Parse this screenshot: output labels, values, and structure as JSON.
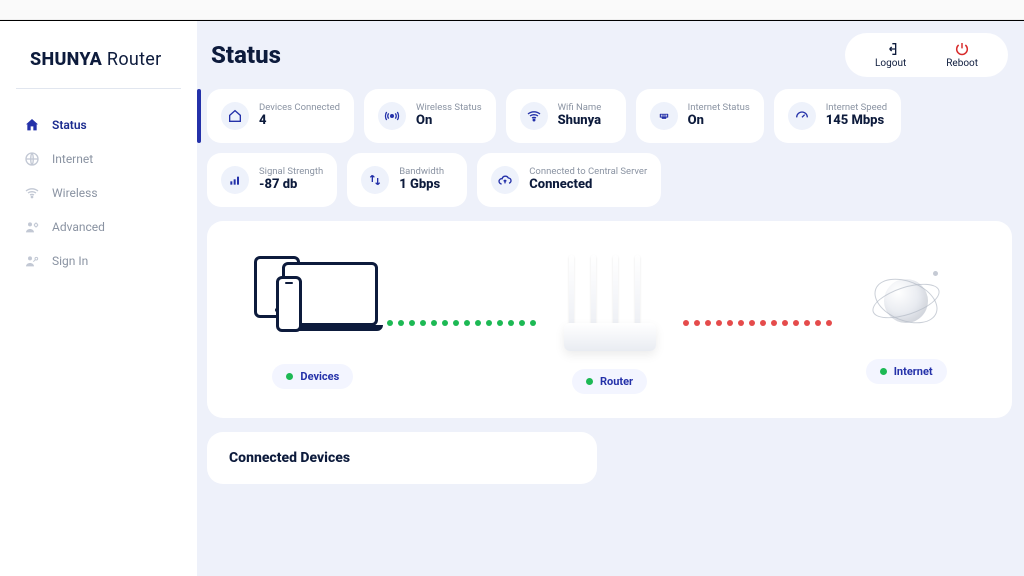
{
  "brand": {
    "bold": "SHUNYA",
    "light": " Router"
  },
  "nav": {
    "items": [
      {
        "label": "Status",
        "icon": "home-icon",
        "active": true
      },
      {
        "label": "Internet",
        "icon": "globe-icon",
        "active": false
      },
      {
        "label": "Wireless",
        "icon": "wifi-icon",
        "active": false
      },
      {
        "label": "Advanced",
        "icon": "user-gear-icon",
        "active": false
      },
      {
        "label": "Sign In",
        "icon": "user-key-icon",
        "active": false
      }
    ]
  },
  "header": {
    "title": "Status",
    "logout_label": "Logout",
    "reboot_label": "Reboot"
  },
  "cards": [
    {
      "label": "Devices Connected",
      "value": "4",
      "icon": "home-outline-icon"
    },
    {
      "label": "Wireless Status",
      "value": "On",
      "icon": "broadcast-icon"
    },
    {
      "label": "Wifi Name",
      "value": "Shunya",
      "icon": "wifi-icon"
    },
    {
      "label": "Internet Status",
      "value": "On",
      "icon": "ethernet-icon"
    },
    {
      "label": "Internet Speed",
      "value": "145 Mbps",
      "icon": "gauge-icon"
    },
    {
      "label": "Signal Strength",
      "value": "-87 db",
      "icon": "signal-bars-icon"
    },
    {
      "label": "Bandwidth",
      "value": "1 Gbps",
      "icon": "transfer-icon"
    },
    {
      "label": "Connected to Central Server",
      "value": "Connected",
      "icon": "cloud-up-icon"
    }
  ],
  "topology": {
    "devices_label": "Devices",
    "router_label": "Router",
    "internet_label": "Internet",
    "link1_color": "green",
    "link2_color": "red"
  },
  "connected_panel": {
    "title": "Connected Devices"
  },
  "colors": {
    "primary": "#2431a9",
    "danger": "#d82b2b",
    "success": "#1db954"
  }
}
